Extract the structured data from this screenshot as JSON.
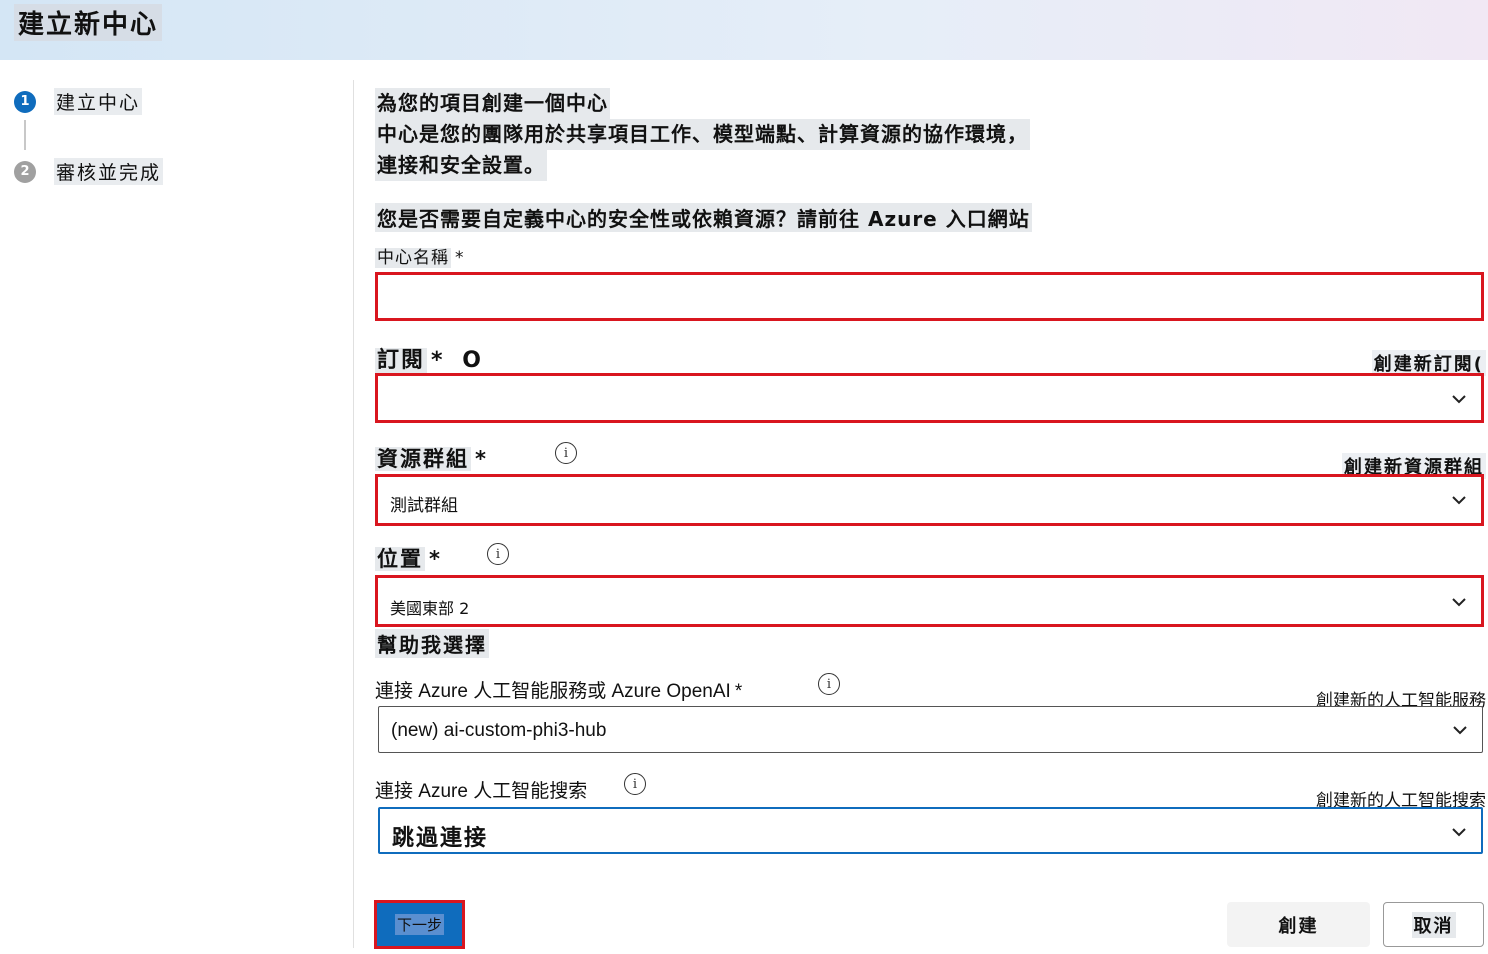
{
  "header": {
    "title": "建立新中心"
  },
  "steps": [
    {
      "number": "1",
      "label": "建立中心",
      "state": "active"
    },
    {
      "number": "2",
      "label": "審核並完成",
      "state": "inactive"
    }
  ],
  "intro": {
    "line1": "為您的項目創建一個中心",
    "line2": "中心是您的團隊用於共享項目工作、模型端點、計算資源的協作環境，",
    "line3": "連接和安全設置。"
  },
  "azure_portal_text": "您是否需要自定義中心的安全性或依賴資源？請前往 Azure 入口網站",
  "hub_name": {
    "label": "中心名稱",
    "required": "*",
    "value": ""
  },
  "subscription": {
    "label": "訂閱",
    "required": "*",
    "extra": "O",
    "create_link": "創建新訂閱(",
    "value": ""
  },
  "resource_group": {
    "label": "資源群組",
    "required": "*",
    "create_link": "創建新資源群組",
    "value": "測試群組"
  },
  "location": {
    "label": "位置",
    "required": "*",
    "value": "美國東部 2",
    "help_link": "幫助我選擇"
  },
  "ai_services": {
    "label": "連接 Azure 人工智能服務或 Azure OpenAI",
    "required": "*",
    "create_link": "創建新的人工智能服務",
    "value": "(new) ai-custom-phi3-hub"
  },
  "ai_search": {
    "label": "連接 Azure 人工智能搜索",
    "create_link": "創建新的人工智能搜索",
    "value": "跳過連接"
  },
  "footer": {
    "next": "下一步",
    "create": "創建",
    "cancel": "取消"
  },
  "icons": {
    "info": "info-icon",
    "chevron": "chevron-down-icon"
  },
  "colors": {
    "accent": "#0f6cbd",
    "highlight_border": "#d9161f"
  }
}
